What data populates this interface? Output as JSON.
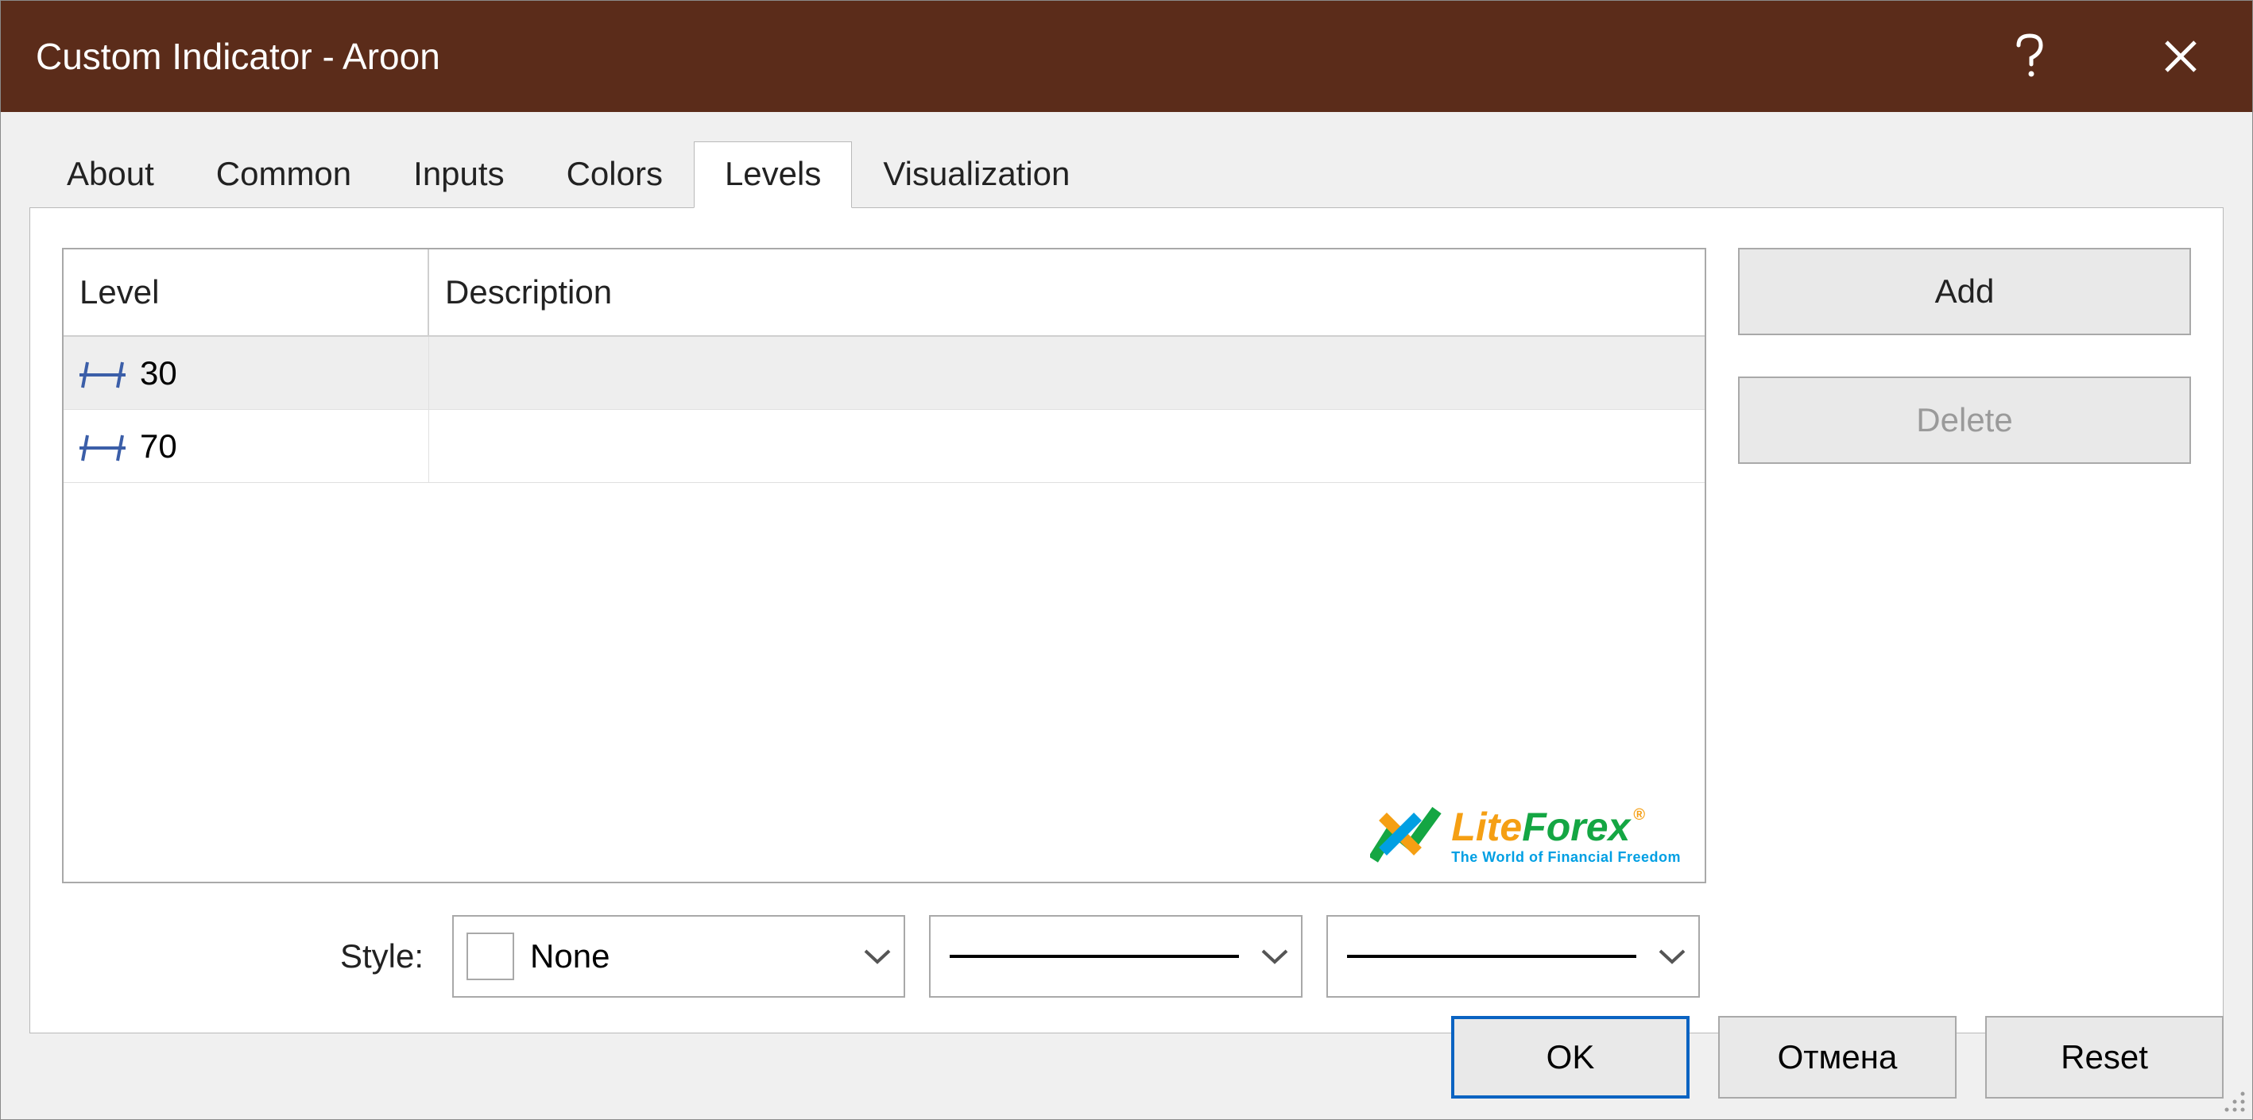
{
  "window": {
    "title": "Custom Indicator - Aroon"
  },
  "tabs": {
    "about": "About",
    "common": "Common",
    "inputs": "Inputs",
    "colors": "Colors",
    "levels": "Levels",
    "visualization": "Visualization",
    "active": "levels"
  },
  "grid": {
    "headers": {
      "level": "Level",
      "description": "Description"
    },
    "rows": [
      {
        "level": "30",
        "description": "",
        "selected": true
      },
      {
        "level": "70",
        "description": "",
        "selected": false
      }
    ]
  },
  "buttons": {
    "add": "Add",
    "delete": "Delete"
  },
  "style": {
    "label": "Style:",
    "color_name": "None",
    "color_value": "#ffffff",
    "line_style": "solid",
    "line_width": "1"
  },
  "footer": {
    "ok": "OK",
    "cancel": "Отмена",
    "reset": "Reset"
  },
  "watermark": {
    "brand_a": "Lite",
    "brand_b": "Forex",
    "tagline": "The World of Financial Freedom"
  }
}
